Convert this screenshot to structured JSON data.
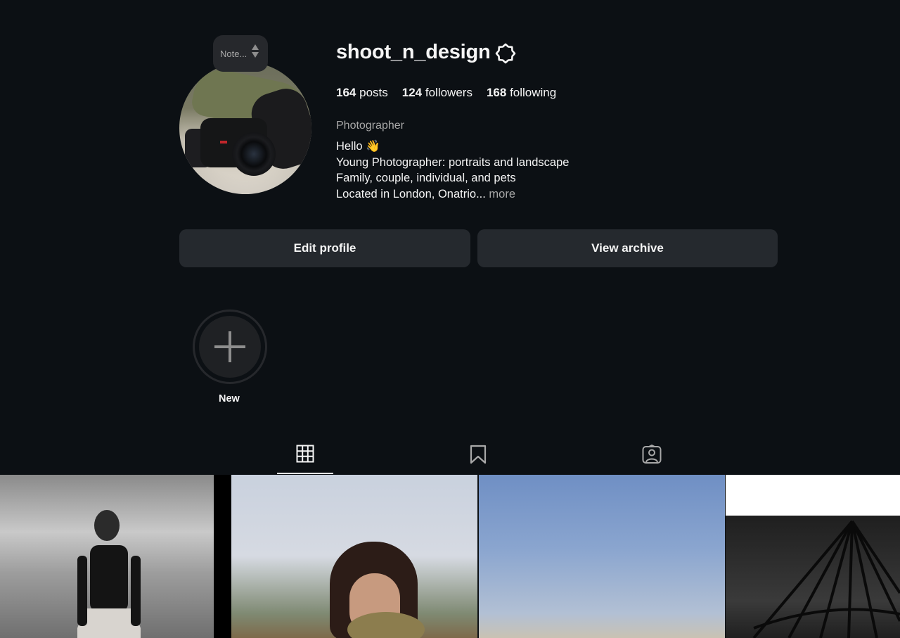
{
  "profile": {
    "note_label": "Note...",
    "username": "shoot_n_design",
    "stats": [
      {
        "count": "164",
        "label": "posts"
      },
      {
        "count": "124",
        "label": "followers"
      },
      {
        "count": "168",
        "label": "following"
      }
    ],
    "category": "Photographer",
    "bio": [
      "Hello 👋",
      "Young Photographer: portraits and landscape",
      "Family, couple, individual, and pets",
      "Located in London, Onatrio..."
    ],
    "more_label": "more"
  },
  "buttons": {
    "edit_profile": "Edit profile",
    "view_archive": "View archive"
  },
  "highlights": {
    "new_label": "New"
  },
  "tabs": [
    {
      "name": "posts",
      "icon": "grid-icon",
      "active": true
    },
    {
      "name": "saved",
      "icon": "bookmark-icon",
      "active": false
    },
    {
      "name": "tagged",
      "icon": "tagged-user-icon",
      "active": false
    }
  ],
  "colors": {
    "background": "#0c1014",
    "button": "#25292e",
    "muted_text": "#a8a8a8"
  }
}
